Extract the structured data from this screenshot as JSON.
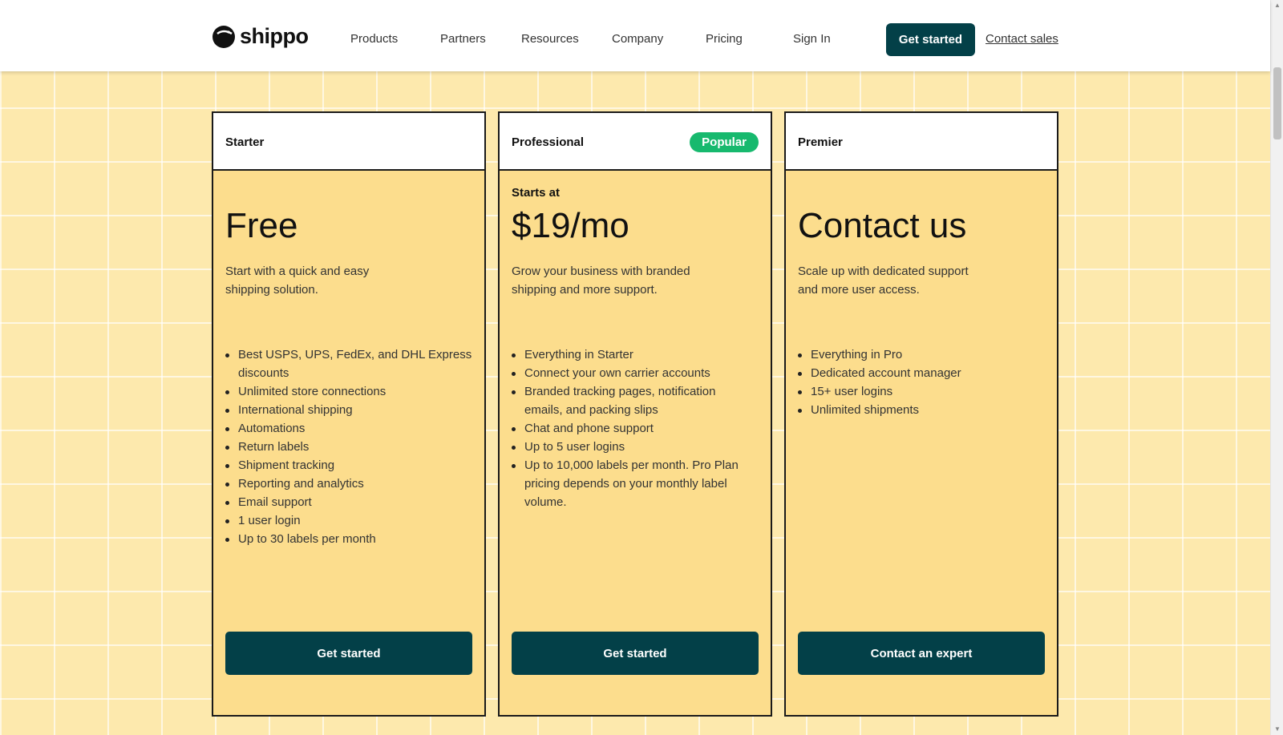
{
  "header": {
    "logo_text": "shippo",
    "nav": [
      "Products",
      "Partners",
      "Resources",
      "Company",
      "Pricing",
      "Sign In"
    ],
    "cta_label": "Get started",
    "contact_label": "Contact sales"
  },
  "plans": [
    {
      "name": "Starter",
      "badge": "",
      "starts_at": "",
      "price": "Free",
      "description": "Start with a quick and easy shipping solution.",
      "features": [
        "Best USPS, UPS, FedEx, and DHL Express discounts",
        "Unlimited store connections",
        "International shipping",
        "Automations",
        "Return labels",
        "Shipment tracking",
        "Reporting and analytics",
        "Email support",
        "1 user login",
        "Up to 30 labels per month"
      ],
      "button": "Get started"
    },
    {
      "name": "Professional",
      "badge": "Popular",
      "starts_at": "Starts at",
      "price": "$19/mo",
      "description": "Grow your business with branded shipping and more support.",
      "features": [
        "Everything in Starter",
        "Connect your own carrier accounts",
        "Branded tracking pages, notification emails, and packing slips",
        "Chat and phone support",
        "Up to 5 user logins",
        "Up to 10,000 labels per month. Pro Plan pricing depends on your monthly label volume."
      ],
      "button": "Get started"
    },
    {
      "name": "Premier",
      "badge": "",
      "starts_at": "",
      "price": "Contact us",
      "description": "Scale up with dedicated support and more user access.",
      "features": [
        "Everything in Pro",
        "Dedicated account manager",
        "15+ user logins",
        "Unlimited shipments"
      ],
      "button": "Contact an expert"
    }
  ],
  "colors": {
    "brand_dark_teal": "#034048",
    "background_yellow": "#fde9ad",
    "card_yellow": "#fcdd8d",
    "badge_green": "#17b96e"
  },
  "icons": {
    "logo": "shippo-logo-icon"
  }
}
